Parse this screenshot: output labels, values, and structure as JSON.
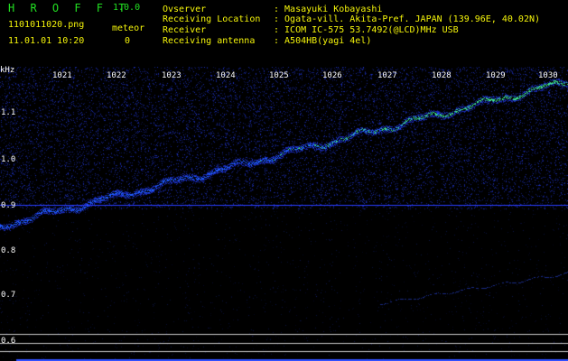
{
  "header": {
    "app_title": "H R O F F T",
    "version": "1.0.0",
    "file_name": "1101011020.png",
    "meteor_label": "meteor",
    "timestamp": "11.01.01 10:20",
    "meteor_count": "0"
  },
  "station": [
    {
      "label": "Ovserver",
      "value": ": Masayuki Kobayashi"
    },
    {
      "label": "Receiving Location",
      "value": ": Ogata-vill. Akita-Pref. JAPAN (139.96E, 40.02N)"
    },
    {
      "label": "Receiver",
      "value": ": ICOM IC-575 53.7492(@LCD)MHz USB"
    },
    {
      "label": "Receiving antenna",
      "value": ": A504HB(yagi 4el)"
    }
  ],
  "spectrogram": {
    "unit_label": "kHz",
    "y_ticks": [
      "1.1",
      "1.0",
      "0.9",
      "0.8",
      "0.7",
      "0.6"
    ],
    "x_ticks": [
      "1021",
      "1022",
      "1023",
      "1024",
      "1025",
      "1026",
      "1027",
      "1028",
      "1029",
      "1030"
    ],
    "colors": {
      "background": "#000000",
      "noise": "#1a2bb8",
      "signal_low": "#1f5bff",
      "signal_high": "#3ee08a",
      "ref_line": "#2a3cff",
      "bottom_lines": "#c8c8c8"
    }
  }
}
